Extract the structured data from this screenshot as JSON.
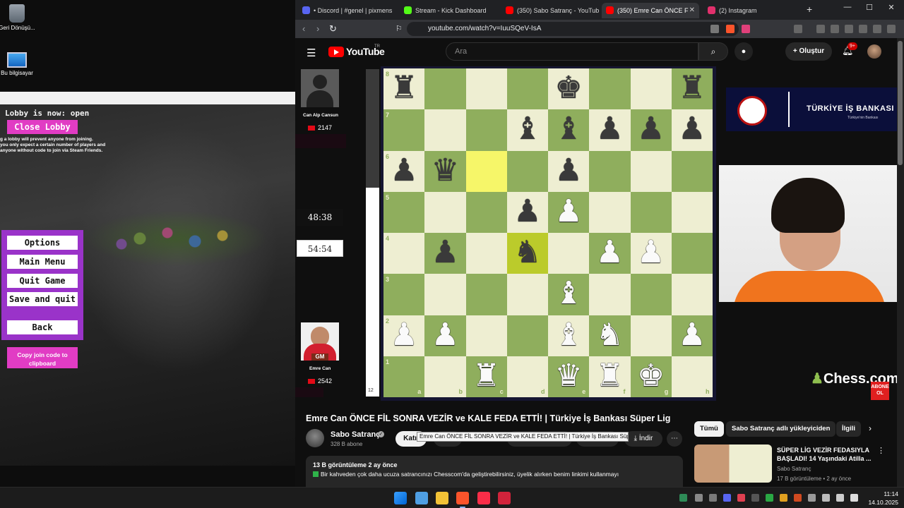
{
  "desktop": {
    "icons": [
      {
        "label": "Geri Dönüşü..."
      },
      {
        "label": "Bu bilgisayar"
      }
    ]
  },
  "game": {
    "lobby_status": "Lobby is now: open",
    "close_lobby": "Close Lobby",
    "lobby_note_1": "g a lobby will prevent anyone from joining.",
    "lobby_note_2": "you only expect a certain number of players and",
    "lobby_note_3": "anyone without code to join via Steam Friends.",
    "menu": {
      "options": "Options",
      "main_menu": "Main Menu",
      "quit_game": "Quit Game",
      "save_and_quit": "Save and quit",
      "back": "Back"
    },
    "copy_code": "Copy join code to clipboard"
  },
  "browser": {
    "tabs": [
      {
        "title": "• Discord | #genel | pixmens",
        "color": "#5865f2"
      },
      {
        "title": "Stream - Kick Dashboard",
        "color": "#53fc18"
      },
      {
        "title": "(350) Sabo Satranç - YouTube",
        "color": "#ff0000"
      },
      {
        "title": "(350) Emre Can ÖNCE F",
        "color": "#ff0000",
        "active": true
      },
      {
        "title": "(2) Instagram",
        "color": "#e1306c"
      }
    ],
    "url": "youtube.com/watch?v=IuuSQeV-IsA"
  },
  "youtube": {
    "logo": "YouTube",
    "logo_tr": "TR",
    "search_placeholder": "Ara",
    "create": "Oluştur",
    "notif_count": "9+",
    "video": {
      "top_player": {
        "name": "Can Alp Cansun",
        "rating": "2147",
        "clock": "48:38"
      },
      "bottom_player": {
        "name": "Emre Can",
        "title": "GM",
        "rating": "2542",
        "clock": "54:54"
      },
      "eval": "12",
      "files": [
        "a",
        "b",
        "c",
        "d",
        "e",
        "f",
        "g",
        "h"
      ],
      "ranks": [
        "8",
        "7",
        "6",
        "5",
        "4",
        "3",
        "2",
        "1"
      ],
      "highlight_squares": [
        "c6",
        "d4"
      ],
      "pieces": [
        {
          "sq": "a8",
          "p": "♜",
          "c": "b"
        },
        {
          "sq": "e8",
          "p": "♚",
          "c": "b"
        },
        {
          "sq": "h8",
          "p": "♜",
          "c": "b"
        },
        {
          "sq": "d7",
          "p": "♝",
          "c": "b"
        },
        {
          "sq": "e7",
          "p": "♝",
          "c": "b"
        },
        {
          "sq": "f7",
          "p": "♟",
          "c": "b"
        },
        {
          "sq": "g7",
          "p": "♟",
          "c": "b"
        },
        {
          "sq": "h7",
          "p": "♟",
          "c": "b"
        },
        {
          "sq": "a6",
          "p": "♟",
          "c": "b"
        },
        {
          "sq": "b6",
          "p": "♛",
          "c": "b"
        },
        {
          "sq": "e6",
          "p": "♟",
          "c": "b"
        },
        {
          "sq": "d5",
          "p": "♟",
          "c": "b"
        },
        {
          "sq": "e5",
          "p": "♟",
          "c": "w"
        },
        {
          "sq": "b4",
          "p": "♟",
          "c": "b"
        },
        {
          "sq": "d4",
          "p": "♞",
          "c": "b"
        },
        {
          "sq": "f4",
          "p": "♟",
          "c": "w"
        },
        {
          "sq": "g4",
          "p": "♟",
          "c": "w"
        },
        {
          "sq": "e3",
          "p": "♝",
          "c": "w"
        },
        {
          "sq": "a2",
          "p": "♟",
          "c": "w"
        },
        {
          "sq": "b2",
          "p": "♟",
          "c": "w"
        },
        {
          "sq": "e2",
          "p": "♝",
          "c": "w"
        },
        {
          "sq": "f2",
          "p": "♞",
          "c": "w"
        },
        {
          "sq": "h2",
          "p": "♟",
          "c": "w"
        },
        {
          "sq": "c1",
          "p": "♜",
          "c": "w"
        },
        {
          "sq": "e1",
          "p": "♛",
          "c": "w"
        },
        {
          "sq": "f1",
          "p": "♜",
          "c": "w"
        },
        {
          "sq": "g1",
          "p": "♚",
          "c": "w"
        }
      ],
      "sponsor": "TÜRKİYE İŞ BANKASI",
      "sponsor_sub": "Türkiye'nin Bankası",
      "chesscom": "Chess.com",
      "abone": "ABONE OL"
    },
    "title": "Emre Can ÖNCE FİL SONRA VEZİR ve KALE FEDA ETTİ! | Türkiye İş Bankası Süper Lig",
    "channel": {
      "name": "Sabo Satranç",
      "subs": "328 B abone",
      "join": "Katıl"
    },
    "download": "İndir",
    "tooltip": "Emre Can ÖNCE FİL SONRA VEZİR ve KALE FEDA ETTİ! | Türkiye İş Bankası Süper Lig",
    "description": {
      "meta": "13 B görüntüleme  2 ay önce",
      "line": "Bir kahveden çok daha ucuza satrancınızı Chesscom'da geliştirebilirsiniz, üyelik alırken benim linkimi kullanmayı"
    },
    "chips": [
      "Tümü",
      "Sabo Satranç adlı yükleyiciden",
      "İlgili"
    ],
    "recommendation": {
      "title": "SÜPER LİG VEZİR FEDASIYLA BAŞLADI! 14 Yaşındaki Atilla ...",
      "channel": "Sabo Satranç",
      "stats": "17 B görüntüleme • 2 ay önce"
    }
  },
  "taskbar": {
    "time": "11:14",
    "date": "14.10.2025"
  }
}
